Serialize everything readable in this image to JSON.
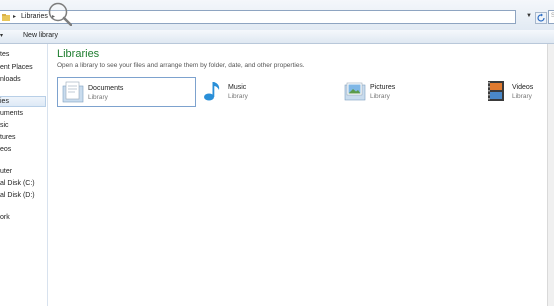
{
  "address": {
    "crumb": "Libraries",
    "search_placeholder": "Se"
  },
  "toolbar": {
    "new_library_label": "New library"
  },
  "nav": {
    "items": [
      {
        "label": "tes"
      },
      {
        "label": "ent Places"
      },
      {
        "label": "nloads"
      },
      {
        "label": "ies",
        "selected": true
      },
      {
        "label": "uments"
      },
      {
        "label": "sic"
      },
      {
        "label": "tures"
      },
      {
        "label": "eos"
      },
      {
        "label": "uter"
      },
      {
        "label": "al Disk (C:)"
      },
      {
        "label": "al Disk (D:)"
      },
      {
        "label": "ork"
      }
    ]
  },
  "main": {
    "title": "Libraries",
    "subtitle": "Open a library to see your files and arrange them by folder, date, and other properties.",
    "libraries": [
      {
        "name": "Documents",
        "type": "Library",
        "icon": "documents-library-icon"
      },
      {
        "name": "Music",
        "type": "Library",
        "icon": "music-library-icon"
      },
      {
        "name": "Pictures",
        "type": "Library",
        "icon": "pictures-library-icon"
      },
      {
        "name": "Videos",
        "type": "Library",
        "icon": "videos-library-icon"
      }
    ]
  },
  "colors": {
    "accent_title": "#1e7d2f",
    "selection_border": "#7da2ce"
  }
}
